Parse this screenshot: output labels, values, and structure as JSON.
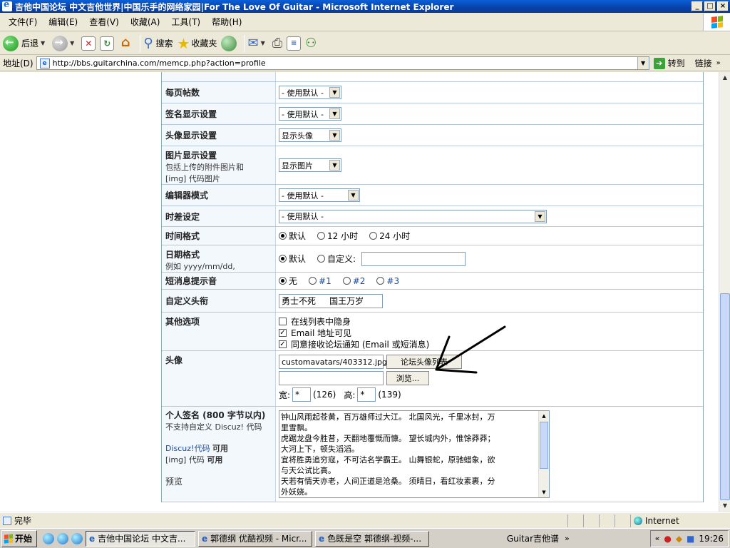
{
  "window": {
    "title": "吉他中国论坛 中文吉他世界|中国乐手的网络家园|For The Love Of Guitar - Microsoft Internet Explorer",
    "btn_min": "_",
    "btn_max": "□",
    "btn_close": "×"
  },
  "menu": [
    "文件(F)",
    "编辑(E)",
    "查看(V)",
    "收藏(A)",
    "工具(T)",
    "帮助(H)"
  ],
  "toolbar": {
    "back": "后退",
    "search": "搜索",
    "favorites": "收藏夹"
  },
  "address": {
    "label": "地址(D)",
    "url": "http://bbs.guitarchina.com/memcp.php?action=profile",
    "go": "转到",
    "links": "链接"
  },
  "form": {
    "posts_per_page": {
      "label": "每页帖数",
      "value": "- 使用默认 -"
    },
    "sig_display": {
      "label": "签名显示设置",
      "value": "- 使用默认 -"
    },
    "avatar_display": {
      "label": "头像显示设置",
      "value": "显示头像"
    },
    "image_display": {
      "label": "图片显示设置",
      "sub1": "包括上传的附件图片和",
      "sub2": "[img] 代码图片",
      "value": "显示图片"
    },
    "editor_mode": {
      "label": "编辑器模式",
      "value": "- 使用默认 -"
    },
    "timezone": {
      "label": "时差设定",
      "value": "- 使用默认 -"
    },
    "time_format": {
      "label": "时间格式",
      "options": [
        "默认",
        "12 小时",
        "24 小时"
      ]
    },
    "date_format": {
      "label": "日期格式",
      "sub": "例如  yyyy/mm/dd, mm/dd/yy",
      "options": [
        "默认",
        "自定义:"
      ]
    },
    "pm_sound": {
      "label": "短消息提示音",
      "options": [
        "无",
        "#1",
        "#2",
        "#3"
      ]
    },
    "custom_title": {
      "label": "自定义头衔",
      "value": "勇士不死     国王万岁"
    },
    "other_options": {
      "label": "其他选项",
      "items": [
        {
          "text": "在线列表中隐身",
          "checked": false
        },
        {
          "text": "Email 地址可见",
          "checked": true
        },
        {
          "text": "同意接收论坛通知 (Email 或短消息)",
          "checked": true
        }
      ]
    },
    "avatar": {
      "label": "头像",
      "path": "customavatars/403312.jpg",
      "gallery_btn": "论坛头像列表",
      "browse_btn": "浏览...",
      "width_label": "宽:",
      "width_value": "*",
      "width_hint": "(126)",
      "height_label": "高:",
      "height_value": "*",
      "height_hint": "(139)"
    },
    "signature": {
      "label": "个人签名 (800 字节以内)",
      "sub1": "不支持自定义 Discuz! 代码",
      "discuz_link": "Discuz!代码",
      "discuz_state": "可用",
      "img_label": "[img] 代码",
      "img_state": "可用",
      "preview": "预览",
      "lines": [
        "钟山风雨起苍黄，百万雄师过大江。      北国风光，千里冰封，万",
        "里雪飘。",
        "虎踞龙盘今胜昔，天翻地覆慨而慷。      望长城内外，惟馀莽莽；",
        "大河上下，顿失滔滔。",
        "宜将胜勇追穷寇，不可沽名学霸王。      山舞银蛇，原驰蜡象，欲",
        "与天公试比高。",
        "天若有情天亦老，人间正道是沧桑。      须晴日，看红妆素裹，分",
        "外妖娆。"
      ]
    }
  },
  "status": {
    "text": "完毕",
    "zone": "Internet"
  },
  "taskbar": {
    "start": "开始",
    "tasks": [
      "吉他中国论坛 中文吉...",
      "郭德纲 优酷视频 - Micr...",
      "色既是空 郭德纲-视频-..."
    ],
    "tray_label": "Guitar吉他谱",
    "clock": "19:26"
  },
  "colors": {
    "title_bar": "#0842a8",
    "label_bg": "#f3f8fd",
    "row_border": "#b8c8d8"
  },
  "icons": [
    "back-icon",
    "forward-icon",
    "stop-icon",
    "refresh-icon",
    "home-icon",
    "search-icon",
    "favorites-icon",
    "history-icon",
    "mail-icon",
    "print-icon",
    "edit-icon",
    "messenger-icon"
  ]
}
